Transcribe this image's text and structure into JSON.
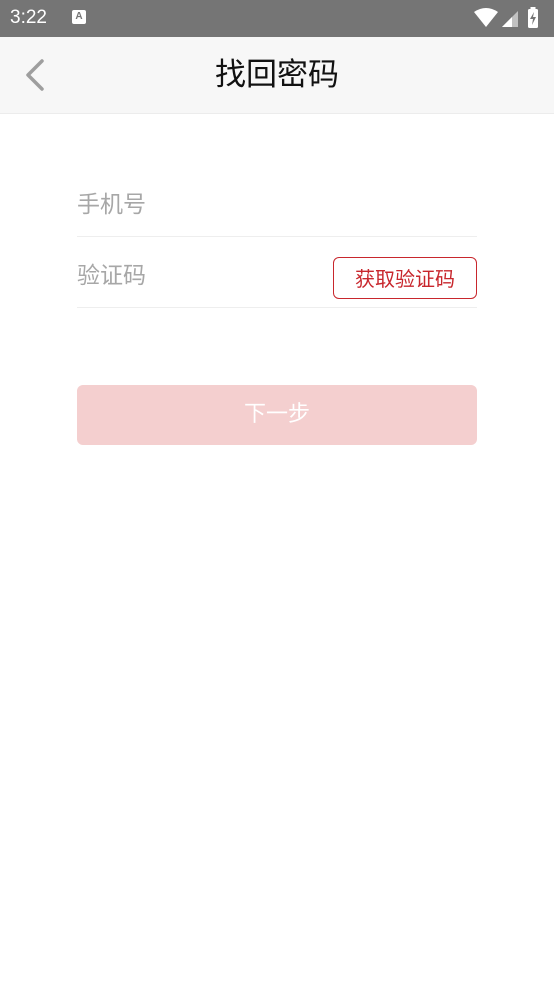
{
  "status_bar": {
    "time": "3:22",
    "notification_icon": "android-notification-icon",
    "wifi_icon": "wifi-icon",
    "signal_icon": "cell-signal-icon",
    "battery_icon": "battery-charging-icon"
  },
  "nav": {
    "back_icon": "chevron-left-icon",
    "title": "找回密码"
  },
  "form": {
    "phone": {
      "value": "",
      "placeholder": "手机号"
    },
    "code": {
      "value": "",
      "placeholder": "验证码"
    },
    "get_code_label": "获取验证码"
  },
  "next_button_label": "下一步",
  "colors": {
    "accent": "#c8272d",
    "button_disabled_bg": "#f4cfcf",
    "status_bar_bg": "#757575",
    "nav_bg": "#f7f7f7"
  }
}
